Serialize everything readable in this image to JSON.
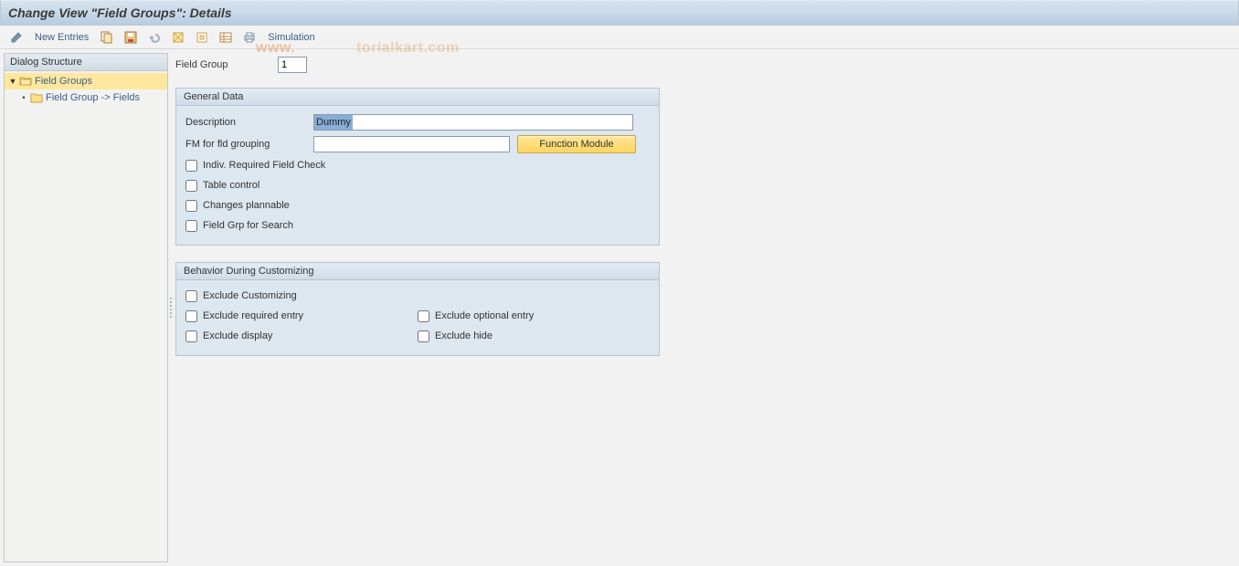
{
  "titlebar": {
    "title": "Change View \"Field Groups\": Details"
  },
  "toolbar": {
    "new_entries": "New Entries",
    "simulation": "Simulation"
  },
  "tree": {
    "header": "Dialog Structure",
    "items": [
      {
        "label": "Field Groups",
        "selected": true,
        "expanded": true
      },
      {
        "label": "Field Group -> Fields",
        "selected": false
      }
    ]
  },
  "main": {
    "field_group_label": "Field Group",
    "field_group_value": "1",
    "group_general": {
      "title": "General Data",
      "description_label": "Description",
      "description_value": "Dummy",
      "fm_label": "FM for fld grouping",
      "fm_value": "",
      "fm_button": "Function Module",
      "check_indiv": "Indiv. Required Field Check",
      "check_table": "Table control",
      "check_changes": "Changes plannable",
      "check_search": "Field Grp for Search"
    },
    "group_behavior": {
      "title": "Behavior During Customizing",
      "excl_cust": "Exclude Customizing",
      "excl_req": "Exclude required entry",
      "excl_opt": "Exclude optional entry",
      "excl_disp": "Exclude display",
      "excl_hide": "Exclude hide"
    }
  },
  "watermark": {
    "w1": "www.",
    "w2": "torialkart.com"
  }
}
